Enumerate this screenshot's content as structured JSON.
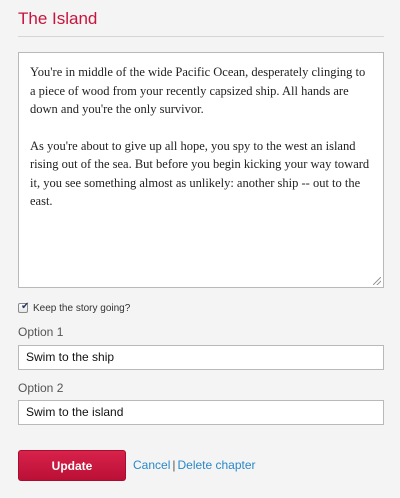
{
  "page": {
    "title": "The Island"
  },
  "story": {
    "paragraphs": [
      "You're in middle of the wide Pacific Ocean,  desperately clinging to a piece of wood from your recently capsized ship. All hands are down and you're the only survivor.",
      "As you're about to give up all hope, you spy to the west an island rising out of the sea. But before you begin kicking  your way toward it, you see something almost as unlikely: another ship -- out to the east."
    ]
  },
  "keep_going": {
    "label": "Keep the story going?",
    "checked": true
  },
  "options": [
    {
      "label": "Option 1",
      "value": "Swim to the ship"
    },
    {
      "label": "Option 2",
      "value": "Swim to the island"
    }
  ],
  "actions": {
    "update_label": "Update",
    "cancel_label": "Cancel",
    "separator": "|",
    "delete_label": "Delete chapter"
  },
  "colors": {
    "title": "#c8143c",
    "button": "#c8173e",
    "link": "#2a88c8"
  }
}
